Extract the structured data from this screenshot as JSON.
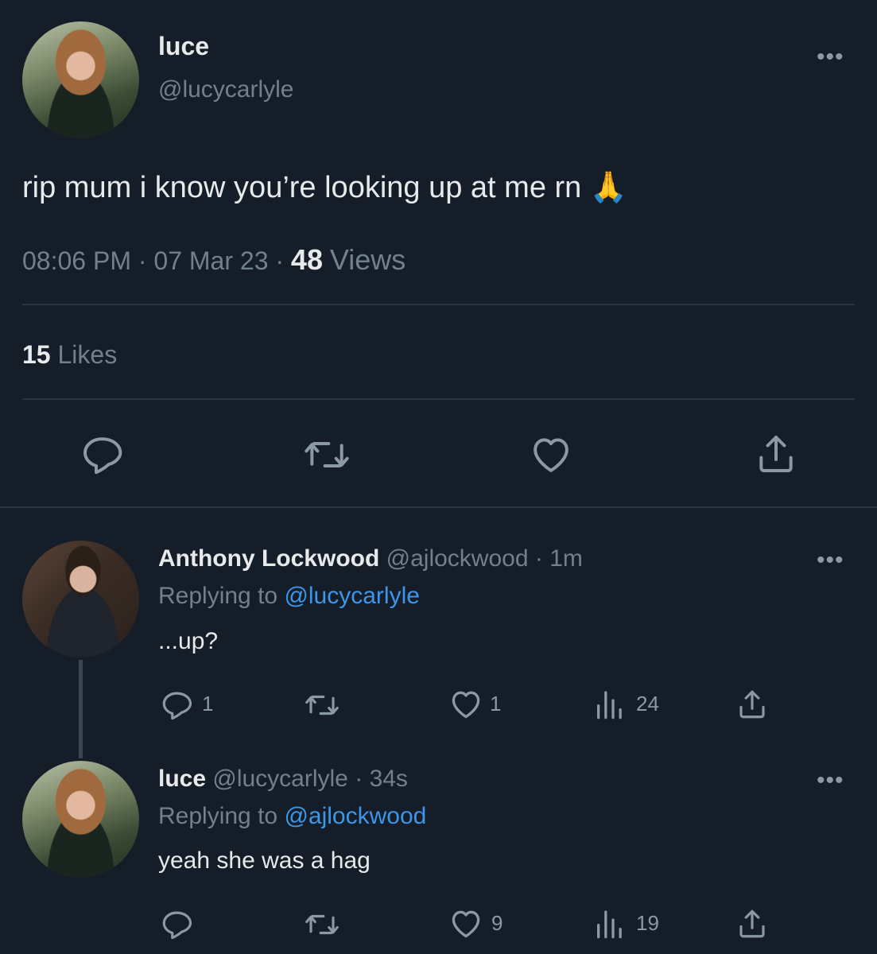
{
  "tweet": {
    "display_name": "luce",
    "handle": "@lucycarlyle",
    "text": "rip mum i know you’re looking up at me rn",
    "emoji": "🙏",
    "time": "08:06 PM",
    "sep1": "·",
    "date": "07 Mar 23",
    "sep2": "·",
    "views_count": "48",
    "views_label": "Views",
    "likes_count": "15",
    "likes_label": "Likes"
  },
  "replies": [
    {
      "display_name": "Anthony Lockwood",
      "handle": "@ajlockwood",
      "sep": "·",
      "age": "1m",
      "replying_label": "Replying to",
      "replying_to": "@lucycarlyle",
      "text": "...up?",
      "reply_count": "1",
      "like_count": "1",
      "view_count": "24"
    },
    {
      "display_name": "luce",
      "handle": "@lucycarlyle",
      "sep": "·",
      "age": "34s",
      "replying_label": "Replying to",
      "replying_to": "@ajlockwood",
      "text": "yeah she was a hag",
      "reply_count": "",
      "like_count": "9",
      "view_count": "19"
    }
  ],
  "icons": {
    "more": "more-icon",
    "reply": "reply-icon",
    "retweet": "retweet-icon",
    "like": "heart-icon",
    "views": "views-icon",
    "share": "share-icon"
  },
  "colors": {
    "background": "#151d28",
    "link": "#3e96e8",
    "muted": "#71808f"
  }
}
